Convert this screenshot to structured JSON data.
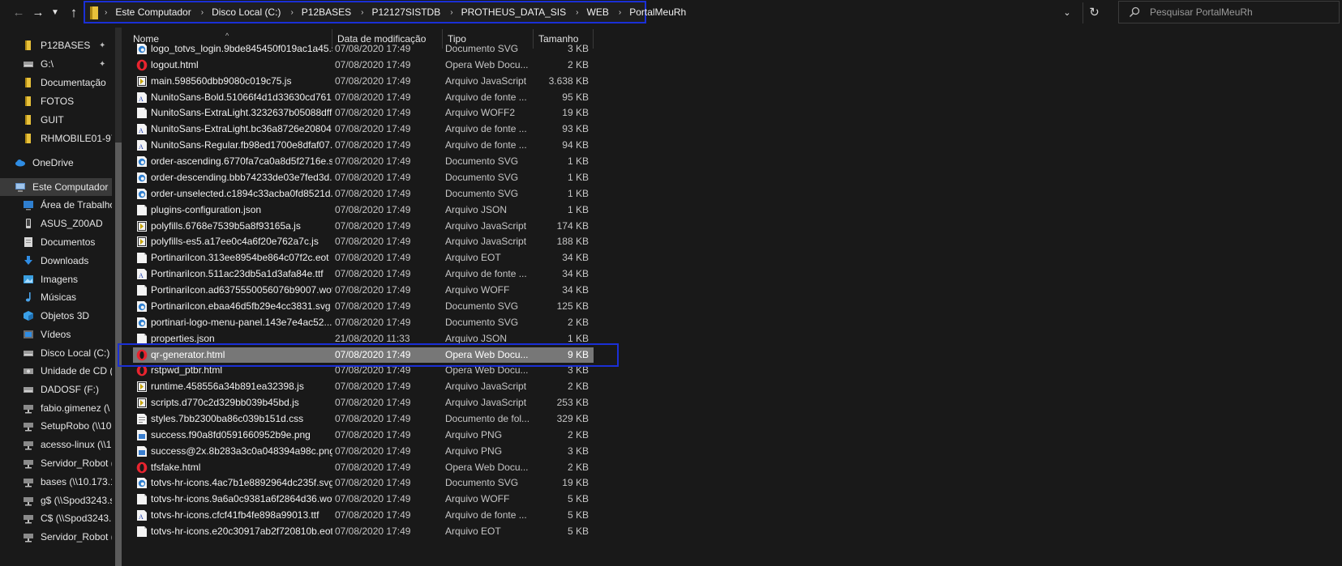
{
  "address_bar": {
    "crumbs": [
      "Este Computador",
      "Disco Local (C:)",
      "P12BASES",
      "P12127SISTDB",
      "PROTHEUS_DATA_SIS",
      "WEB",
      "PortalMeuRh"
    ]
  },
  "search": {
    "placeholder": "Pesquisar PortalMeuRh"
  },
  "sidebar": {
    "items": [
      {
        "label": "P12BASES",
        "icon": "folder-icon",
        "pinned": true
      },
      {
        "label": "G:\\",
        "icon": "drive-icon",
        "pinned": true
      },
      {
        "label": "Documentação",
        "icon": "folder-icon",
        "pinned": false
      },
      {
        "label": "FOTOS",
        "icon": "folder-icon",
        "pinned": false
      },
      {
        "label": "GUIT",
        "icon": "folder-icon",
        "pinned": false
      },
      {
        "label": "RHMOBILE01-97",
        "icon": "folder-icon",
        "pinned": false
      },
      {
        "label": "OneDrive",
        "icon": "cloud-icon",
        "pinned": false
      },
      {
        "label": "Este Computador",
        "icon": "computer-icon",
        "pinned": false,
        "selected": true
      },
      {
        "label": "Área de Trabalho",
        "icon": "desktop-icon",
        "pinned": false
      },
      {
        "label": "ASUS_Z00AD",
        "icon": "phone-icon",
        "pinned": false
      },
      {
        "label": "Documentos",
        "icon": "documents-icon",
        "pinned": false
      },
      {
        "label": "Downloads",
        "icon": "download-icon",
        "pinned": false
      },
      {
        "label": "Imagens",
        "icon": "pictures-icon",
        "pinned": false
      },
      {
        "label": "Músicas",
        "icon": "music-icon",
        "pinned": false
      },
      {
        "label": "Objetos 3D",
        "icon": "cube-icon",
        "pinned": false
      },
      {
        "label": "Vídeos",
        "icon": "video-icon",
        "pinned": false
      },
      {
        "label": "Disco Local (C:)",
        "icon": "drive-icon",
        "pinned": false
      },
      {
        "label": "Unidade de CD (",
        "icon": "cd-icon",
        "pinned": false
      },
      {
        "label": "DADOSF (F:)",
        "icon": "drive-icon",
        "pinned": false
      },
      {
        "label": "fabio.gimenez (\\",
        "icon": "network-drive-icon",
        "pinned": false
      },
      {
        "label": "SetupRobo (\\\\10",
        "icon": "network-drive-icon",
        "pinned": false
      },
      {
        "label": "acesso-linux (\\\\1",
        "icon": "network-drive-icon",
        "pinned": false
      },
      {
        "label": "Servidor_Robot (",
        "icon": "network-drive-icon",
        "pinned": false
      },
      {
        "label": "bases (\\\\10.173.1",
        "icon": "network-drive-icon",
        "pinned": false
      },
      {
        "label": "g$ (\\\\Spod3243.s",
        "icon": "network-drive-icon",
        "pinned": false
      },
      {
        "label": "C$ (\\\\Spod3243.",
        "icon": "network-drive-icon",
        "pinned": false
      },
      {
        "label": "Servidor_Robot (",
        "icon": "network-drive-icon",
        "pinned": false
      }
    ]
  },
  "columns": {
    "name": "Nome",
    "date": "Data de modificação",
    "type": "Tipo",
    "size": "Tamanho"
  },
  "files": [
    {
      "name": "logo_totvs_login.9bde845450f019ac1a45.s...",
      "date": "07/08/2020 17:49",
      "type": "Documento SVG",
      "size": "3 KB",
      "icon": "edge-svg-icon"
    },
    {
      "name": "logout.html",
      "date": "07/08/2020 17:49",
      "type": "Opera Web Docu...",
      "size": "2 KB",
      "icon": "opera-icon"
    },
    {
      "name": "main.598560dbb9080c019c75.js",
      "date": "07/08/2020 17:49",
      "type": "Arquivo JavaScript",
      "size": "3.638 KB",
      "icon": "js-file-icon"
    },
    {
      "name": "NunitoSans-Bold.51066f4d1d33630cd761....",
      "date": "07/08/2020 17:49",
      "type": "Arquivo de fonte ...",
      "size": "95 KB",
      "icon": "font-file-icon"
    },
    {
      "name": "NunitoSans-ExtraLight.3232637b05088dff...",
      "date": "07/08/2020 17:49",
      "type": "Arquivo WOFF2",
      "size": "19 KB",
      "icon": "blank-file-icon"
    },
    {
      "name": "NunitoSans-ExtraLight.bc36a8726e20804...",
      "date": "07/08/2020 17:49",
      "type": "Arquivo de fonte ...",
      "size": "93 KB",
      "icon": "font-file-icon"
    },
    {
      "name": "NunitoSans-Regular.fb98ed1700e8dfaf07...",
      "date": "07/08/2020 17:49",
      "type": "Arquivo de fonte ...",
      "size": "94 KB",
      "icon": "font-file-icon"
    },
    {
      "name": "order-ascending.6770fa7ca0a8d5f2716e.s...",
      "date": "07/08/2020 17:49",
      "type": "Documento SVG",
      "size": "1 KB",
      "icon": "edge-svg-icon"
    },
    {
      "name": "order-descending.bbb74233de03e7fed3d...",
      "date": "07/08/2020 17:49",
      "type": "Documento SVG",
      "size": "1 KB",
      "icon": "edge-svg-icon"
    },
    {
      "name": "order-unselected.c1894c33acba0fd8521d...",
      "date": "07/08/2020 17:49",
      "type": "Documento SVG",
      "size": "1 KB",
      "icon": "edge-svg-icon"
    },
    {
      "name": "plugins-configuration.json",
      "date": "07/08/2020 17:49",
      "type": "Arquivo JSON",
      "size": "1 KB",
      "icon": "blank-file-icon"
    },
    {
      "name": "polyfills.6768e7539b5a8f93165a.js",
      "date": "07/08/2020 17:49",
      "type": "Arquivo JavaScript",
      "size": "174 KB",
      "icon": "js-file-icon"
    },
    {
      "name": "polyfills-es5.a17ee0c4a6f20e762a7c.js",
      "date": "07/08/2020 17:49",
      "type": "Arquivo JavaScript",
      "size": "188 KB",
      "icon": "js-file-icon"
    },
    {
      "name": "PortinariIcon.313ee8954be864c07f2c.eot",
      "date": "07/08/2020 17:49",
      "type": "Arquivo EOT",
      "size": "34 KB",
      "icon": "blank-file-icon"
    },
    {
      "name": "PortinariIcon.511ac23db5a1d3afa84e.ttf",
      "date": "07/08/2020 17:49",
      "type": "Arquivo de fonte ...",
      "size": "34 KB",
      "icon": "font-file-icon"
    },
    {
      "name": "PortinariIcon.ad6375550056076b9007.woff",
      "date": "07/08/2020 17:49",
      "type": "Arquivo WOFF",
      "size": "34 KB",
      "icon": "blank-file-icon"
    },
    {
      "name": "PortinariIcon.ebaa46d5fb29e4cc3831.svg",
      "date": "07/08/2020 17:49",
      "type": "Documento SVG",
      "size": "125 KB",
      "icon": "edge-svg-icon"
    },
    {
      "name": "portinari-logo-menu-panel.143e7e4ac52...",
      "date": "07/08/2020 17:49",
      "type": "Documento SVG",
      "size": "2 KB",
      "icon": "edge-svg-icon"
    },
    {
      "name": "properties.json",
      "date": "21/08/2020 11:33",
      "type": "Arquivo JSON",
      "size": "1 KB",
      "icon": "blank-file-icon"
    },
    {
      "name": "qr-generator.html",
      "date": "07/08/2020 17:49",
      "type": "Opera Web Docu...",
      "size": "9 KB",
      "icon": "opera-icon",
      "selected": true
    },
    {
      "name": "rstpwd_ptbr.html",
      "date": "07/08/2020 17:49",
      "type": "Opera Web Docu...",
      "size": "3 KB",
      "icon": "opera-icon"
    },
    {
      "name": "runtime.458556a34b891ea32398.js",
      "date": "07/08/2020 17:49",
      "type": "Arquivo JavaScript",
      "size": "2 KB",
      "icon": "js-file-icon"
    },
    {
      "name": "scripts.d770c2d329bb039b45bd.js",
      "date": "07/08/2020 17:49",
      "type": "Arquivo JavaScript",
      "size": "253 KB",
      "icon": "js-file-icon"
    },
    {
      "name": "styles.7bb2300ba86c039b151d.css",
      "date": "07/08/2020 17:49",
      "type": "Documento de fol...",
      "size": "329 KB",
      "icon": "css-file-icon"
    },
    {
      "name": "success.f90a8fd0591660952b9e.png",
      "date": "07/08/2020 17:49",
      "type": "Arquivo PNG",
      "size": "2 KB",
      "icon": "image-file-icon"
    },
    {
      "name": "success@2x.8b283a3c0a048394a98c.png",
      "date": "07/08/2020 17:49",
      "type": "Arquivo PNG",
      "size": "3 KB",
      "icon": "image-file-icon"
    },
    {
      "name": "tfsfake.html",
      "date": "07/08/2020 17:49",
      "type": "Opera Web Docu...",
      "size": "2 KB",
      "icon": "opera-icon"
    },
    {
      "name": "totvs-hr-icons.4ac7b1e8892964dc235f.svg",
      "date": "07/08/2020 17:49",
      "type": "Documento SVG",
      "size": "19 KB",
      "icon": "edge-svg-icon"
    },
    {
      "name": "totvs-hr-icons.9a6a0c9381a6f2864d36.woff",
      "date": "07/08/2020 17:49",
      "type": "Arquivo WOFF",
      "size": "5 KB",
      "icon": "blank-file-icon"
    },
    {
      "name": "totvs-hr-icons.cfcf41fb4fe898a99013.ttf",
      "date": "07/08/2020 17:49",
      "type": "Arquivo de fonte ...",
      "size": "5 KB",
      "icon": "font-file-icon"
    },
    {
      "name": "totvs-hr-icons.e20c30917ab2f720810b.eot",
      "date": "07/08/2020 17:49",
      "type": "Arquivo EOT",
      "size": "5 KB",
      "icon": "blank-file-icon"
    }
  ],
  "colors": {
    "background": "#191919",
    "highlight_outline": "#1a2fd6",
    "selected_row": "#777777",
    "folder_yellow": "#e8c13a"
  }
}
